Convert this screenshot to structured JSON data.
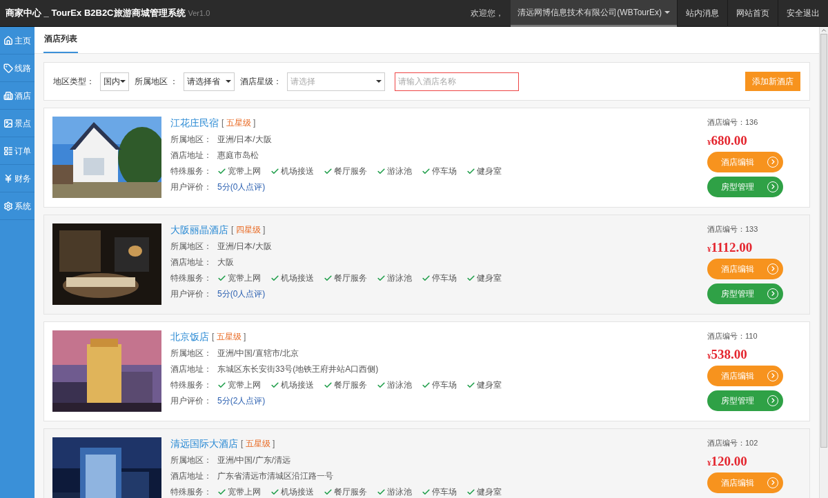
{
  "header": {
    "brand": "商家中心 _ TourEx B2B2C旅游商城管理系统",
    "version": "Ver1.0",
    "welcome": "欢迎您，",
    "account": "清远网博信息技术有限公司(WBTourEx)",
    "links": [
      "站内消息",
      "网站首页",
      "安全退出"
    ]
  },
  "sidebar": {
    "items": [
      {
        "label": "主页"
      },
      {
        "label": "线路"
      },
      {
        "label": "酒店"
      },
      {
        "label": "景点"
      },
      {
        "label": "订单"
      },
      {
        "label": "财务"
      },
      {
        "label": "系统"
      }
    ]
  },
  "tab": {
    "label": "酒店列表"
  },
  "filters": [
    {
      "label": "地区类型：",
      "value": "国内"
    },
    {
      "label": "所属地区 ：",
      "value": "请选择省"
    },
    {
      "label": "酒店星级：",
      "placeholder": "请选择"
    }
  ],
  "search": {
    "placeholder": "请输入酒店名称"
  },
  "add_button": "添加新酒店",
  "hotels": [
    {
      "name": "江花庄民宿",
      "grade_open": "[",
      "grade": "五星级",
      "grade_close": "]",
      "region_label": "所属地区：",
      "region": "亚洲/日本/大阪",
      "address_label": "酒店地址：",
      "address": "惠庭市岛松",
      "services_label": "特殊服务：",
      "services": [
        "宽带上网",
        "机场接送",
        "餐厅服务",
        "游泳池",
        "停车场",
        "健身室"
      ],
      "rating_label": "用户评价：",
      "rating": "5分(0人点评)",
      "id_label": "酒店编号：136",
      "currency": "¥",
      "price": "680.00",
      "buttons": [
        {
          "label": "酒店编辑",
          "kind": "edit"
        },
        {
          "label": "房型管理",
          "kind": "rooms"
        }
      ]
    },
    {
      "name": "大阪丽晶酒店",
      "grade_open": "[",
      "grade": "四星级",
      "grade_close": "]",
      "region_label": "所属地区：",
      "region": "亚洲/日本/大阪",
      "address_label": "酒店地址：",
      "address": "大阪",
      "services_label": "特殊服务：",
      "services": [
        "宽带上网",
        "机场接送",
        "餐厅服务",
        "游泳池",
        "停车场",
        "健身室"
      ],
      "rating_label": "用户评价：",
      "rating": "5分(0人点评)",
      "id_label": "酒店编号：133",
      "currency": "¥",
      "price": "1112.00",
      "buttons": [
        {
          "label": "酒店编辑",
          "kind": "edit"
        },
        {
          "label": "房型管理",
          "kind": "rooms"
        }
      ]
    },
    {
      "name": "北京饭店",
      "grade_open": "[",
      "grade": "五星级",
      "grade_close": "]",
      "region_label": "所属地区：",
      "region": "亚洲/中国/直辖市/北京",
      "address_label": "酒店地址：",
      "address": "东城区东长安街33号(地铁王府井站A口西侧)",
      "services_label": "特殊服务：",
      "services": [
        "宽带上网",
        "机场接送",
        "餐厅服务",
        "游泳池",
        "停车场",
        "健身室"
      ],
      "rating_label": "用户评价：",
      "rating": "5分(2人点评)",
      "id_label": "酒店编号：110",
      "currency": "¥",
      "price": "538.00",
      "buttons": [
        {
          "label": "酒店编辑",
          "kind": "edit"
        },
        {
          "label": "房型管理",
          "kind": "rooms"
        }
      ]
    },
    {
      "name": "清远国际大酒店",
      "grade_open": "[",
      "grade": "五星级",
      "grade_close": "]",
      "region_label": "所属地区：",
      "region": "亚洲/中国/广东/清远",
      "address_label": "酒店地址：",
      "address": "广东省清远市清城区沿江路一号",
      "services_label": "特殊服务：",
      "services": [
        "宽带上网",
        "机场接送",
        "餐厅服务",
        "游泳池",
        "停车场",
        "健身室"
      ],
      "id_label": "酒店编号：102",
      "currency": "¥",
      "price": "120.00",
      "buttons": [
        {
          "label": "酒店编辑",
          "kind": "edit"
        }
      ]
    }
  ]
}
